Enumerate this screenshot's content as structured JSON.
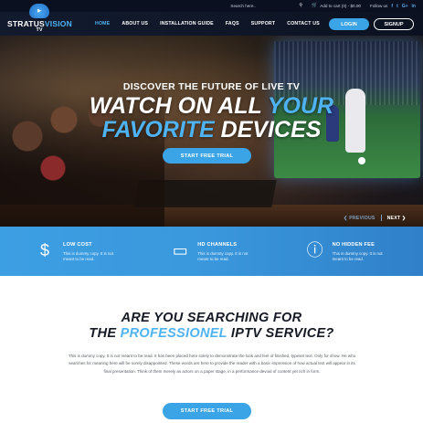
{
  "topbar": {
    "search_placeholder": "Search here..",
    "cart_text": "Add to cart (0) - $0.00",
    "follow_label": "Follow us",
    "social": [
      "f",
      "t",
      "G+",
      "in"
    ]
  },
  "logo": {
    "brand_part1": "STRATUS",
    "brand_part2": "VISION",
    "brand_suffix": "TV"
  },
  "nav": {
    "items": [
      "HOME",
      "ABOUT US",
      "INSTALLATION GUIDE",
      "FAQS",
      "SUPPORT",
      "CONTACT US"
    ],
    "active_index": 0,
    "login_label": "LOGIN",
    "signup_label": "SIGNUP"
  },
  "hero": {
    "subtitle": "DISCOVER THE FUTURE OF LIVE TV",
    "title_line1_a": "WATCH ON ",
    "title_line1_b": "ALL ",
    "title_line1_c": "YOUR",
    "title_line2_a": "FAVORITE ",
    "title_line2_b": "DEVICES",
    "cta_label": "START FREE TRIAL",
    "prev_label": "❮ PREVIOUS",
    "next_label": "NEXT ❯"
  },
  "features": [
    {
      "icon": "money-hand-icon",
      "title": "LOW COST",
      "text": "This is dummy copy. It is not meant to be read."
    },
    {
      "icon": "smart-tv-icon",
      "title": "HD CHANNELS",
      "text": "This is dummy copy. It is not meant to be read."
    },
    {
      "icon": "no-fee-icon",
      "title": "NO HIDDEN FEE",
      "text": "This is dummy copy. It is not meant to be read."
    }
  ],
  "about": {
    "heading_line1": "ARE YOU SEARCHING FOR",
    "heading_line2_a": "THE ",
    "heading_line2_b": "PROFESSIONEL",
    "heading_line2_c": " IPTV SERVICE?",
    "body": "This is dummy copy. It is not meant to be read. It has been placed here solely to demonstrate the look and feel of finished, typeset text. Only for show. He who searches for meaning here will be sorely disappointed. These words are here to provide the reader with a basic impression of how actual text will appear in its final presentation. Think of them merely as actors on a paper stage, in a performance devoid of content yet rich in form.",
    "cta_label": "START FREE TRIAL"
  },
  "colors": {
    "accent": "#3aa4e6",
    "accent_text": "#4fb3f2",
    "topbar_bg": "#0b1020",
    "header_bg": "#121a2e"
  }
}
